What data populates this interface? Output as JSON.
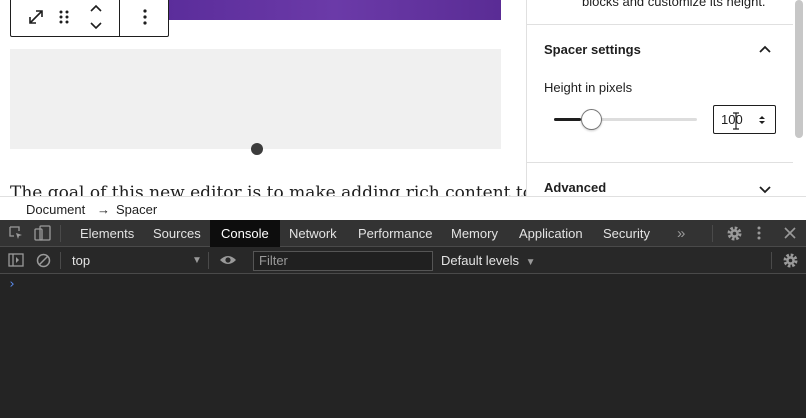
{
  "editor": {
    "paragraph_text": "The goal of this new editor is to make adding rich content to",
    "toolbar": {
      "icons": [
        "resize-icon",
        "drag-handle-icon",
        "move-up-down-icon",
        "more-options-icon"
      ]
    }
  },
  "sidebar": {
    "desc_text": "blocks and customize its height.",
    "spacer_settings": {
      "title": "Spacer settings",
      "height_label": "Height in pixels",
      "height_value": "100",
      "slider_fraction": 0.19
    },
    "advanced_title": "Advanced"
  },
  "breadcrumb": {
    "items": [
      "Document",
      "Spacer"
    ],
    "separator": "→"
  },
  "devtools": {
    "tabs": [
      "Elements",
      "Sources",
      "Console",
      "Network",
      "Performance",
      "Memory",
      "Application",
      "Security"
    ],
    "active_tab": "Console",
    "overflow": "»",
    "context": "top",
    "filter_placeholder": "Filter",
    "levels": "Default levels",
    "prompt": "›"
  },
  "colors": {
    "accent_purple": "#5b2d9b",
    "devtools_bg": "#242424",
    "prompt_blue": "#5b8df0"
  }
}
